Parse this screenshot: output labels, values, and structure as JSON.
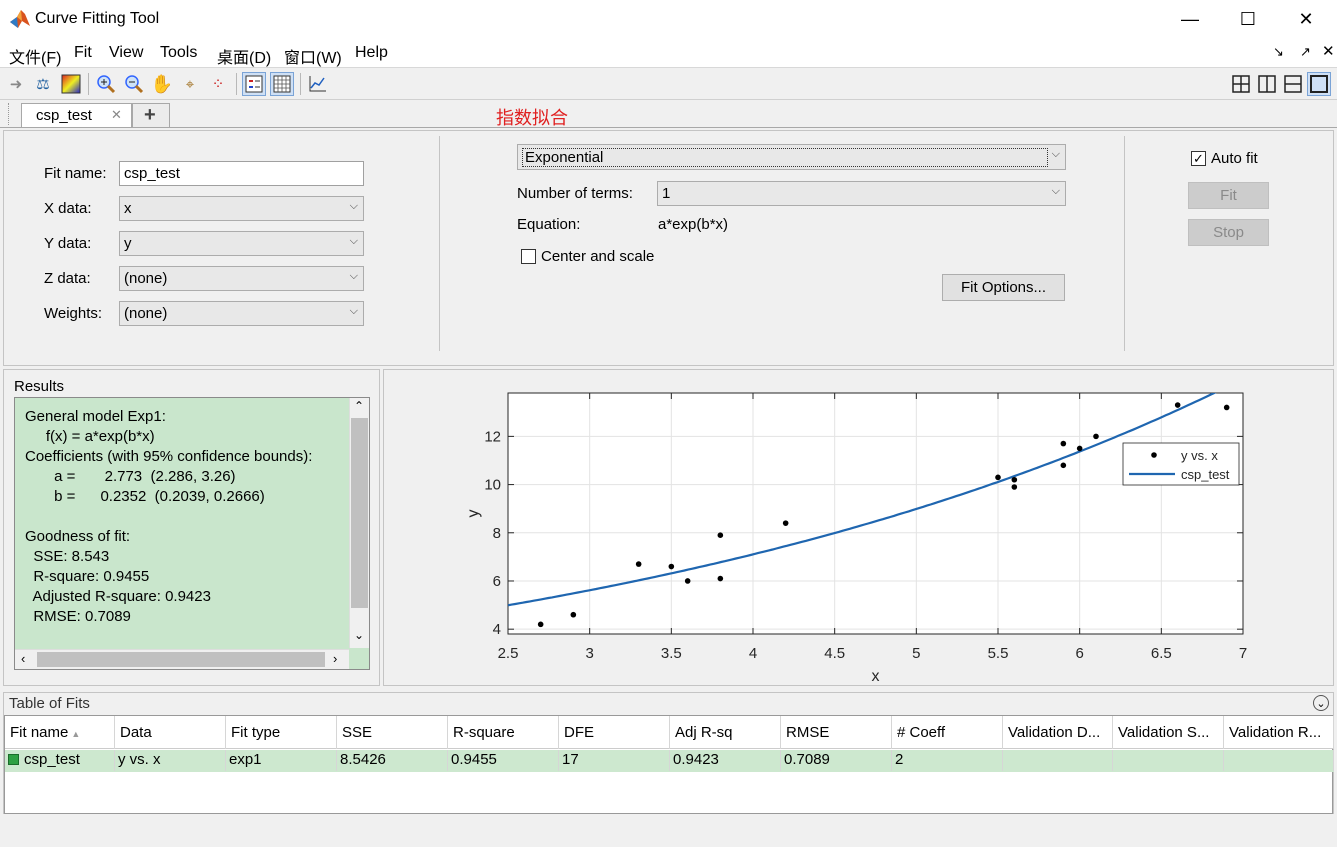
{
  "window": {
    "title": "Curve Fitting Tool",
    "minimize": "—",
    "maximize": "☐",
    "close": "✕"
  },
  "menu": [
    "文件(F)",
    "Fit",
    "View",
    "Tools",
    "桌面(D)",
    "窗口(W)",
    "Help"
  ],
  "tabs": {
    "active": "csp_test",
    "close_glyph": "✕",
    "add_glyph": "+",
    "annotation": "指数拟合",
    "annotation_color": "#e02020"
  },
  "fit_panel": {
    "fit_name_label": "Fit name:",
    "fit_name_value": "csp_test",
    "x_label": "X data:",
    "x_value": "x",
    "y_label": "Y data:",
    "y_value": "y",
    "z_label": "Z data:",
    "z_value": "(none)",
    "w_label": "Weights:",
    "w_value": "(none)",
    "arrow": "⌵"
  },
  "model_panel": {
    "model_type": "Exponential",
    "terms_label": "Number of terms:",
    "terms_value": "1",
    "equation_label": "Equation:",
    "equation_value": "a*exp(b*x)",
    "center_scale_label": "Center and scale",
    "fit_options_label": "Fit Options..."
  },
  "actions": {
    "auto_fit_label": "Auto fit",
    "auto_fit_checked": "✓",
    "fit_label": "Fit",
    "stop_label": "Stop"
  },
  "results": {
    "heading": "Results",
    "lines": [
      "General model Exp1:",
      "     f(x) = a*exp(b*x)",
      "Coefficients (with 95% confidence bounds):",
      "       a =       2.773  (2.286, 3.26)",
      "       b =      0.2352  (0.2039, 0.2666)",
      "",
      "Goodness of fit:",
      "  SSE: 8.543",
      "  R-square: 0.9455",
      "  Adjusted R-square: 0.9423",
      "  RMSE: 0.7089"
    ],
    "bg_color": "#c9e6cc"
  },
  "chart_data": {
    "type": "scatter",
    "xlabel": "x",
    "ylabel": "y",
    "xlim": [
      2.5,
      7
    ],
    "ylim": [
      3.8,
      13.8
    ],
    "xticks": [
      "2.5",
      "3",
      "3.5",
      "4",
      "4.5",
      "5",
      "5.5",
      "6",
      "6.5",
      "7"
    ],
    "yticks": [
      "4",
      "6",
      "8",
      "10",
      "12"
    ],
    "xtick_values": [
      2.5,
      3,
      3.5,
      4,
      4.5,
      5,
      5.5,
      6,
      6.5,
      7
    ],
    "ytick_values": [
      4,
      6,
      8,
      10,
      12
    ],
    "grid": true,
    "legend_position": "top-right",
    "series": [
      {
        "name": "y vs. x",
        "kind": "points",
        "color": "#000000",
        "x": [
          2.7,
          2.9,
          3.3,
          3.5,
          3.6,
          3.8,
          3.8,
          4.2,
          5.5,
          5.6,
          5.6,
          5.9,
          5.9,
          6.0,
          6.1,
          6.6,
          6.9
        ],
        "y": [
          4.2,
          4.6,
          6.7,
          6.6,
          6.0,
          7.9,
          6.1,
          8.4,
          10.3,
          10.2,
          9.9,
          11.7,
          10.8,
          11.5,
          12.0,
          13.3,
          13.2
        ]
      },
      {
        "name": "csp_test",
        "kind": "curve",
        "color": "#1f66b0",
        "a": 2.773,
        "b": 0.2352
      }
    ]
  },
  "table": {
    "heading": "Table of Fits",
    "collapse_glyph": "⌄",
    "columns": [
      "Fit name",
      "Data",
      "Fit type",
      "SSE",
      "R-square",
      "DFE",
      "Adj R-sq",
      "RMSE",
      "# Coeff",
      "Validation D...",
      "Validation S...",
      "Validation R..."
    ],
    "sort_glyph": "▲",
    "rows": [
      [
        "csp_test",
        "y vs. x",
        "exp1",
        "8.5426",
        "0.9455",
        "17",
        "0.9423",
        "0.7089",
        "2",
        "",
        "",
        ""
      ]
    ],
    "row_color": "#cde8cf",
    "status_color": "#2ea043"
  }
}
